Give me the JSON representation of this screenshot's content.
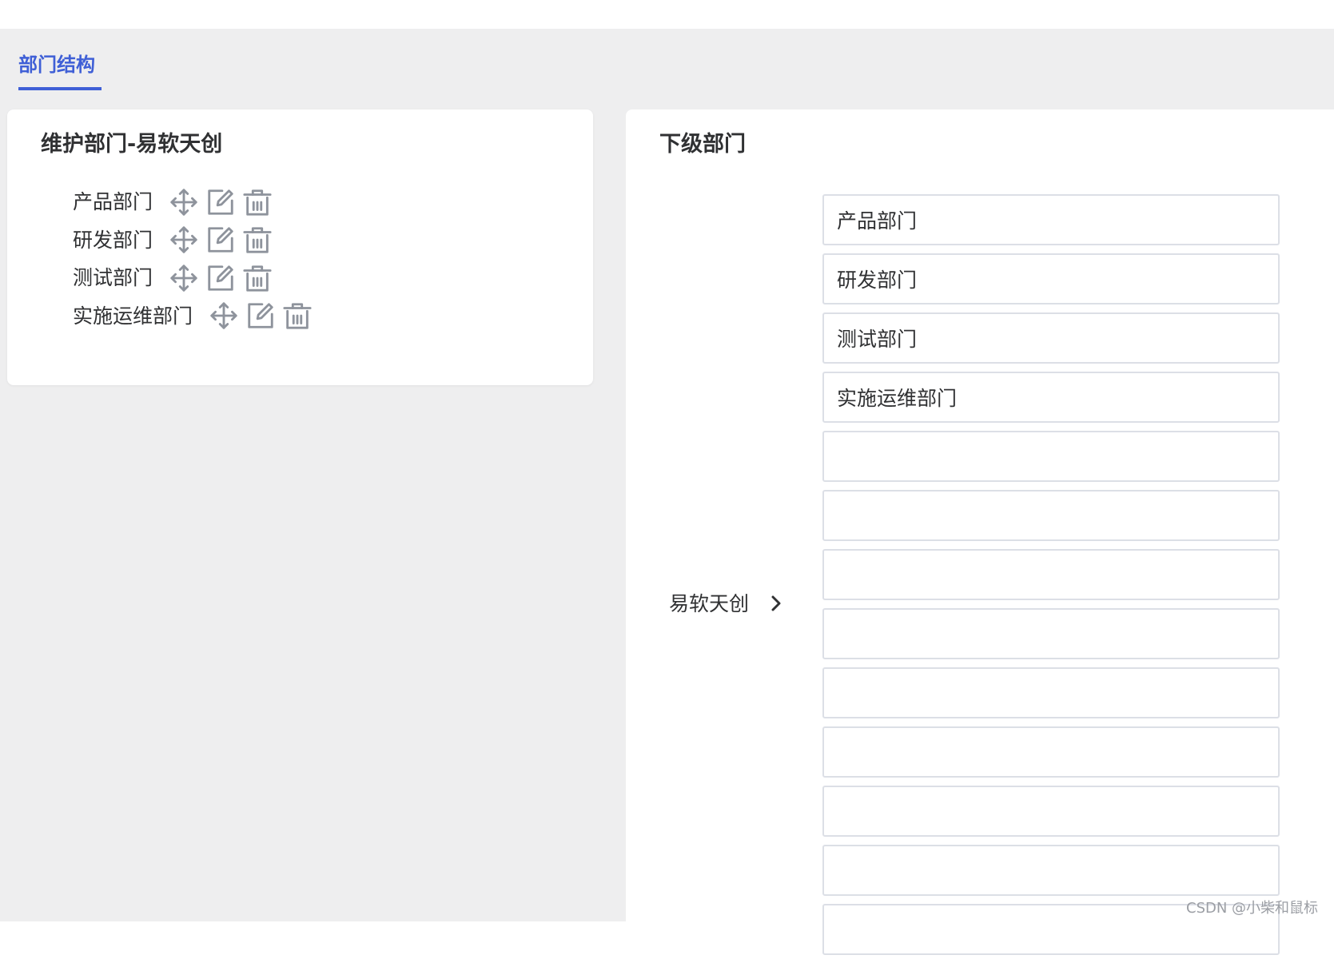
{
  "tab": {
    "label": "部门结构"
  },
  "left_card": {
    "title": "维护部门-易软天创",
    "items": [
      {
        "label": "产品部门"
      },
      {
        "label": "研发部门"
      },
      {
        "label": "测试部门"
      },
      {
        "label": "实施运维部门"
      }
    ]
  },
  "right_card": {
    "title": "下级部门",
    "parent": "易软天创",
    "inputs": [
      "产品部门",
      "研发部门",
      "测试部门",
      "实施运维部门",
      "",
      "",
      "",
      "",
      "",
      "",
      "",
      "",
      ""
    ]
  },
  "watermark": "CSDN @小柴和鼠标",
  "icons": {
    "move": "move-icon",
    "edit": "edit-icon",
    "delete": "trash-icon",
    "chevron": "chevron-right-icon"
  },
  "colors": {
    "accent": "#3f5fd6",
    "icon": "#8e939c",
    "background": "#eeeeef"
  }
}
